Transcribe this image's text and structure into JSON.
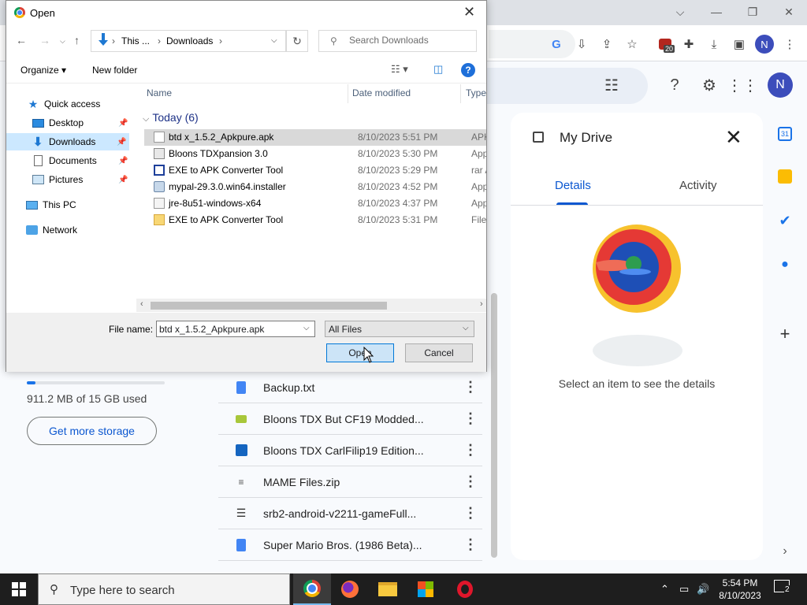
{
  "dialog": {
    "title": "Open",
    "breadcrumb": [
      "This ...",
      "Downloads"
    ],
    "search_placeholder": "Search Downloads",
    "toolbar": {
      "organize": "Organize",
      "new_folder": "New folder"
    },
    "nav": [
      {
        "label": "Quick access",
        "icon": "star-icon"
      },
      {
        "label": "Desktop",
        "icon": "desktop-icon",
        "pinned": true
      },
      {
        "label": "Downloads",
        "icon": "download-icon",
        "pinned": true,
        "selected": true
      },
      {
        "label": "Documents",
        "icon": "documents-icon",
        "pinned": true
      },
      {
        "label": "Pictures",
        "icon": "pictures-icon",
        "pinned": true
      },
      {
        "label": "This PC",
        "icon": "pc-icon"
      },
      {
        "label": "Network",
        "icon": "network-icon"
      }
    ],
    "columns": {
      "name": "Name",
      "date": "Date modified",
      "type": "Type"
    },
    "group": "Today (6)",
    "files": [
      {
        "name": "btd x_1.5.2_Apkpure.apk",
        "date": "8/10/2023 5:51 PM",
        "type": "APK F",
        "selected": true
      },
      {
        "name": "Bloons TDXpansion 3.0",
        "date": "8/10/2023 5:30 PM",
        "type": "Appli"
      },
      {
        "name": "EXE to APK Converter Tool",
        "date": "8/10/2023 5:29 PM",
        "type": "rar Ar"
      },
      {
        "name": "mypal-29.3.0.win64.installer",
        "date": "8/10/2023 4:52 PM",
        "type": "Appli"
      },
      {
        "name": "jre-8u51-windows-x64",
        "date": "8/10/2023 4:37 PM",
        "type": "Appli"
      },
      {
        "name": "EXE to APK Converter Tool",
        "date": "8/10/2023 5:31 PM",
        "type": "File fo"
      }
    ],
    "filename_label": "File name:",
    "filename_value": "btd x_1.5.2_Apkpure.apk",
    "filetype_value": "All Files",
    "open_label": "Open",
    "cancel_label": "Cancel"
  },
  "browser": {
    "extension_badge": "20",
    "profile_initial": "N"
  },
  "drive": {
    "avatar_initial": "N",
    "storage_used_fraction": 0.06,
    "storage_text": "911.2 MB of 15 GB used",
    "storage_button": "Get more storage",
    "files": [
      {
        "name": "Backup.txt",
        "icon": "doc-icon"
      },
      {
        "name": "Bloons TDX But CF19 Modded...",
        "icon": "apk-icon"
      },
      {
        "name": "Bloons TDX CarlFilip19 Edition...",
        "icon": "image-icon"
      },
      {
        "name": "MAME Files.zip",
        "icon": "zip-icon"
      },
      {
        "name": "srb2-android-v2211-gameFull...",
        "icon": "list-icon"
      },
      {
        "name": "Super Mario Bros. (1986 Beta)...",
        "icon": "doc-icon"
      }
    ],
    "details": {
      "title": "My Drive",
      "tab_details": "Details",
      "tab_activity": "Activity",
      "message": "Select an item to see the details"
    },
    "side_calendar_day": "31"
  },
  "taskbar": {
    "search_placeholder": "Type here to search",
    "time": "5:54 PM",
    "date": "8/10/2023",
    "notifications": "2"
  }
}
